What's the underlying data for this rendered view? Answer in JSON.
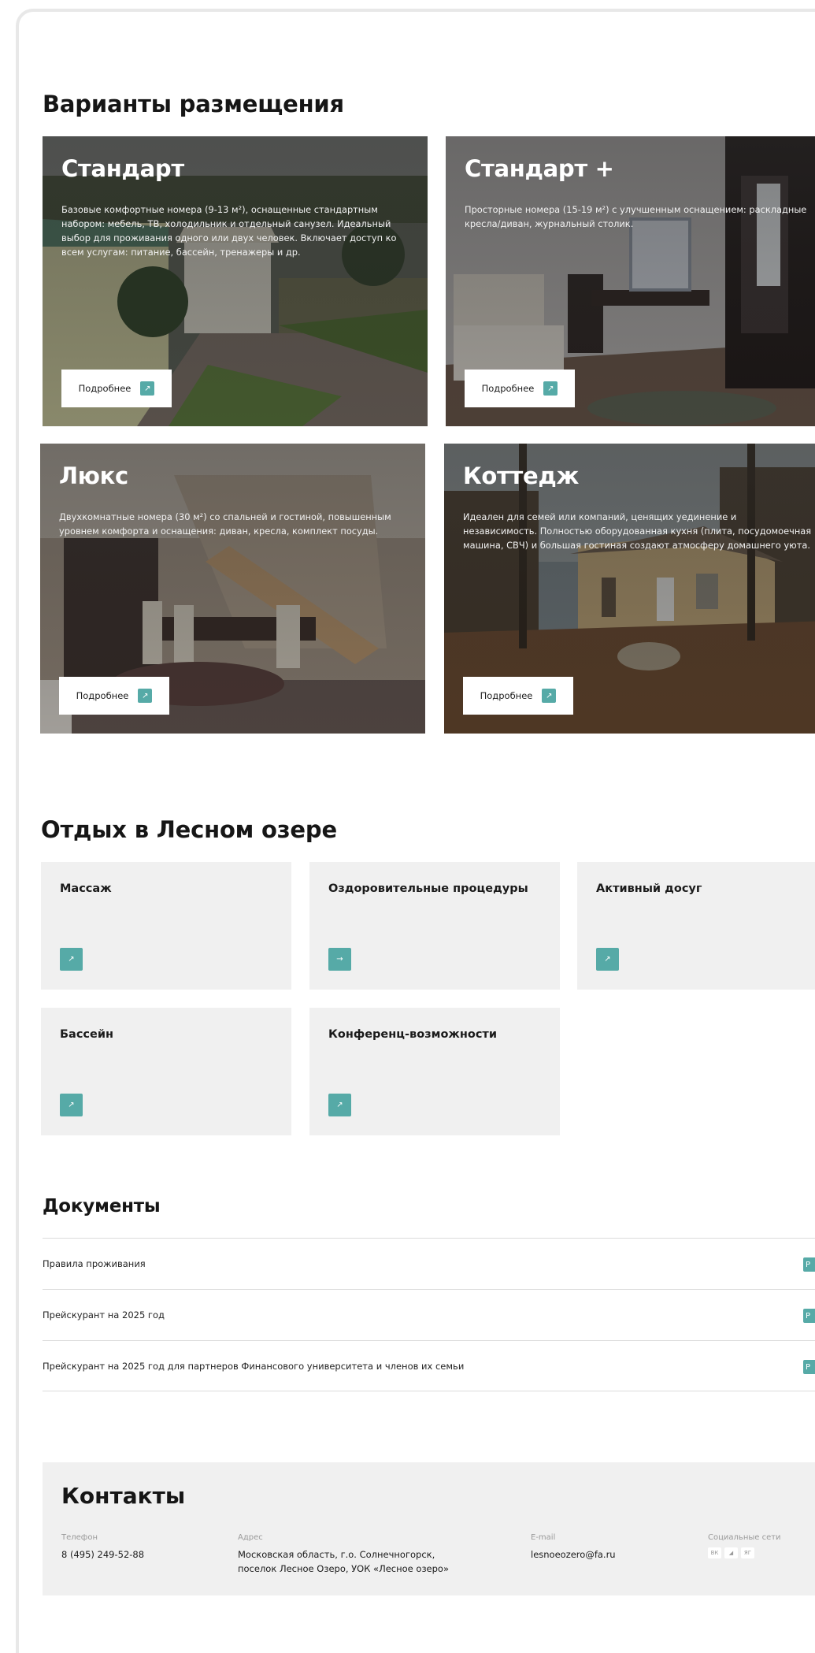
{
  "accommodation": {
    "title": "Варианты размещения",
    "more_label": "Подробнее",
    "rooms": [
      {
        "title": "Стандарт",
        "text": "Базовые комфортные номера (9-13 м²), оснащенные стандартным набором: мебель, ТВ, холодильник и отдельный санузел. Идеальный выбор для проживания одного или двух человек. Включает доступ ко всем услугам: питание, бассейн, тренажеры и др."
      },
      {
        "title": "Стандарт +",
        "text": "Просторные номера (15-19 м²) с улучшенным оснащением: раскладные кресла/диван, журнальный столик."
      },
      {
        "title": "Люкс",
        "text": "Двухкомнатные номера (30 м²) со спальней и гостиной, повышенным уровнем комфорта и оснащения: диван, кресла, комплект посуды."
      },
      {
        "title": "Коттедж",
        "text": "Идеален для семей или компаний, ценящих уединение и независимость. Полностью оборудованная кухня (плита, посудомоечная машина, СВЧ) и большая гостиная создают атмосферу домашнего уюта."
      }
    ]
  },
  "leisure": {
    "title": "Отдых в Лесном озере",
    "items": [
      {
        "label": "Массаж",
        "icon": "arrow-up-right-icon",
        "glyph": "↗"
      },
      {
        "label": "Оздоровительные процедуры",
        "icon": "arrow-right-icon",
        "glyph": "→"
      },
      {
        "label": "Активный досуг",
        "icon": "arrow-up-right-icon",
        "glyph": "↗"
      },
      {
        "label": "Бассейн",
        "icon": "arrow-up-right-icon",
        "glyph": "↗"
      },
      {
        "label": "Конференц-возможности",
        "icon": "arrow-up-right-icon",
        "glyph": "↗"
      }
    ]
  },
  "documents": {
    "title": "Документы",
    "badge": "P",
    "items": [
      "Правила проживания",
      "Прейскурант на 2025 год",
      "Прейскурант на 2025 год для партнеров Финансового университета и членов их семьи"
    ]
  },
  "contacts": {
    "title": "Контакты",
    "phone_label": "Телефон",
    "phone": "8 (495) 249-52-88",
    "address_label": "Адрес",
    "address_line1": "Московская область, г.о. Солнечногорск,",
    "address_line2": "поселок Лесное Озеро, УОК «Лесное озеро»",
    "email_label": "E-mail",
    "email": "lesnoeozero@fa.ru",
    "social_label": "Социальные сети",
    "social": [
      "ВК",
      "◢",
      "ЯГ"
    ]
  },
  "colors": {
    "accent": "#56aaa7",
    "panel": "#f0f0f0"
  }
}
